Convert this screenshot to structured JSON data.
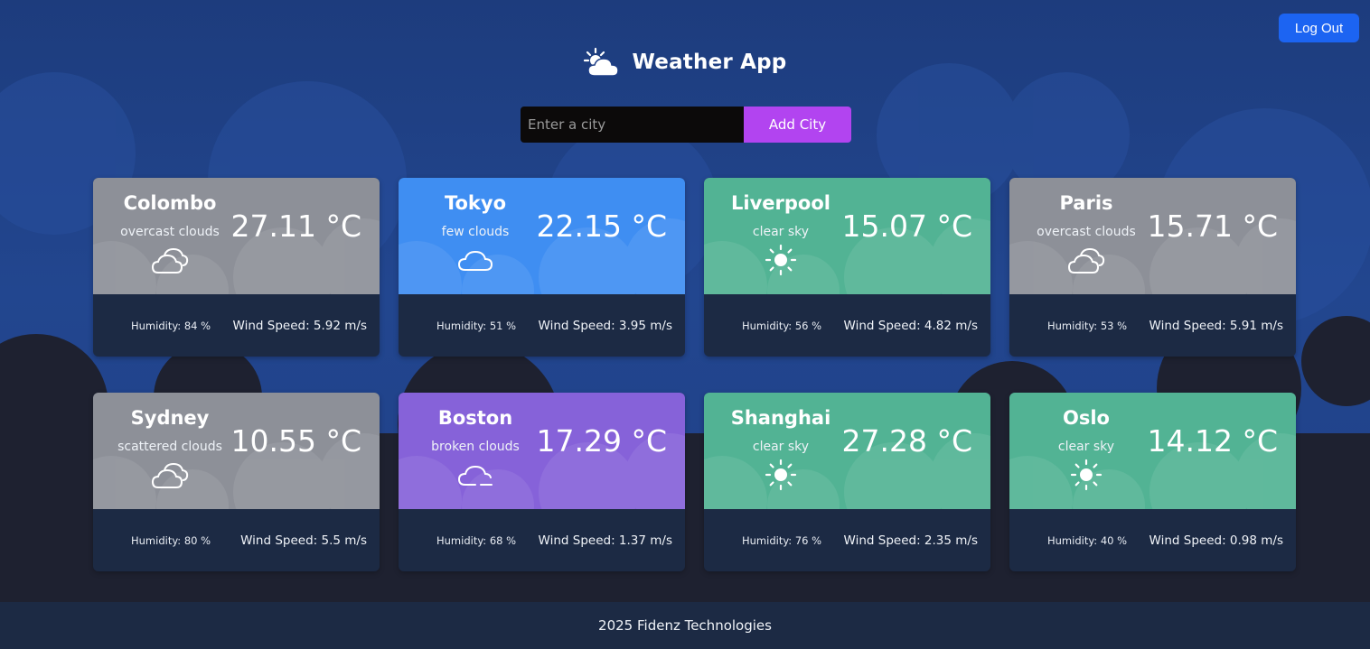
{
  "app": {
    "title": "Weather App",
    "logo_icon": "sun-behind-cloud-icon",
    "logout_label": "Log Out"
  },
  "search": {
    "placeholder": "Enter a city",
    "value": "",
    "button_label": "Add City"
  },
  "colors": {
    "logout": "#1c64f2",
    "add_city": "#b244f0",
    "cloudy": "#8d9098",
    "few_clouds": "#3f8ef2",
    "clear": "#52b394",
    "broken": "#8662d9",
    "card_bottom": "#1c2a44"
  },
  "cards": [
    {
      "city": "Colombo",
      "description": "overcast clouds",
      "icon": "clouds-icon",
      "temp": "27.11 °C",
      "humidity": "Humidity: 84 %",
      "wind": "Wind Speed: 5.92 m/s"
    },
    {
      "city": "Tokyo",
      "description": "few clouds",
      "icon": "cloud-icon",
      "temp": "22.15 °C",
      "humidity": "Humidity: 51 %",
      "wind": "Wind Speed: 3.95 m/s"
    },
    {
      "city": "Liverpool",
      "description": "clear sky",
      "icon": "sun-icon",
      "temp": "15.07 °C",
      "humidity": "Humidity: 56 %",
      "wind": "Wind Speed: 4.82 m/s"
    },
    {
      "city": "Paris",
      "description": "overcast clouds",
      "icon": "clouds-icon",
      "temp": "15.71 °C",
      "humidity": "Humidity: 53 %",
      "wind": "Wind Speed: 5.91 m/s"
    },
    {
      "city": "Sydney",
      "description": "scattered clouds",
      "icon": "clouds-icon",
      "temp": "10.55 °C",
      "humidity": "Humidity: 80 %",
      "wind": "Wind Speed: 5.5 m/s"
    },
    {
      "city": "Boston",
      "description": "broken clouds",
      "icon": "cloud-minus-icon",
      "temp": "17.29 °C",
      "humidity": "Humidity: 68 %",
      "wind": "Wind Speed: 1.37 m/s"
    },
    {
      "city": "Shanghai",
      "description": "clear sky",
      "icon": "sun-icon",
      "temp": "27.28 °C",
      "humidity": "Humidity: 76 %",
      "wind": "Wind Speed: 2.35 m/s"
    },
    {
      "city": "Oslo",
      "description": "clear sky",
      "icon": "sun-icon",
      "temp": "14.12 °C",
      "humidity": "Humidity: 40 %",
      "wind": "Wind Speed: 0.98 m/s"
    }
  ],
  "footer": {
    "text": "2025 Fidenz Technologies"
  }
}
